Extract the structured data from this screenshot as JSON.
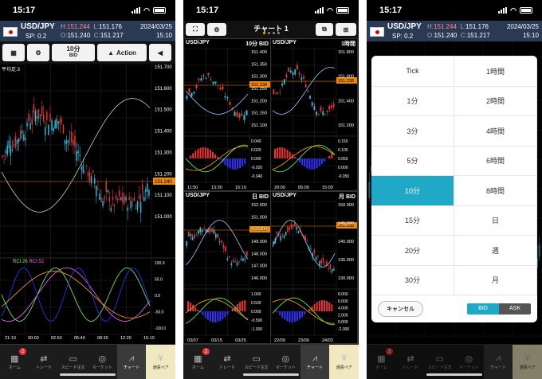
{
  "status": {
    "time": "15:17"
  },
  "quote": {
    "symbol": "USD/JPY",
    "spread": "SP: 0.2",
    "high_label": "H:",
    "high": "151.244",
    "open_label": "O:",
    "open": "151.240",
    "low_label": "L:",
    "low": "151.176",
    "close_label": "C:",
    "close": "151.217",
    "date": "2024/03/25",
    "time": "15:10"
  },
  "toolbar1": {
    "timeframe": "10分",
    "side": "BID",
    "action": "Action"
  },
  "chart1": {
    "ma_label": "平均足:3",
    "price_ticks": [
      "151.700",
      "151.600",
      "151.500",
      "151.400",
      "151.300",
      "151.200",
      "151.100",
      "151.000"
    ],
    "current_price": "151.240",
    "osc_labels": [
      "RCI:26",
      "RCI:52"
    ],
    "osc_ticks": [
      "100.0",
      "50.0",
      "0.0",
      "-50.0",
      "-100.0"
    ],
    "time_ticks": [
      "21:10",
      "00:00",
      "02:50",
      "05:40",
      "08:30",
      "12:20",
      "15:10"
    ]
  },
  "screen2": {
    "title": "チャート 1",
    "panels": [
      {
        "symbol": "USD/JPY",
        "tf": "10分",
        "side": "BID",
        "price": "151.238",
        "ticks": [
          "151.400",
          "151.350",
          "151.300",
          "151.250",
          "151.200",
          "151.150",
          "151.100"
        ],
        "osc_ticks": [
          "0.040",
          "0.020",
          "0.000",
          "-0.020",
          "-0.040"
        ],
        "time_ticks": [
          "11:50",
          "13:30",
          "15:10"
        ]
      },
      {
        "symbol": "USD/JPY",
        "tf": "1時間",
        "side": "",
        "price": "151.238",
        "ticks": [
          "151.800",
          "151.600",
          "151.400",
          "151.200"
        ],
        "osc_ticks": [
          "0.150",
          "0.100",
          "0.050",
          "0.000",
          "-0.050"
        ],
        "time_ticks": [
          "20:00",
          "05:00",
          "15:00"
        ]
      },
      {
        "symbol": "USD/JPY",
        "tf": "日",
        "side": "BID",
        "price": "151.238",
        "ticks": [
          "152.000",
          "151.000",
          "150.000",
          "149.000",
          "148.000",
          "147.000",
          "146.000"
        ],
        "osc_ticks": [
          "1.000",
          "0.500",
          "0.000",
          "-0.500",
          "-1.000"
        ],
        "time_ticks": [
          "03/07",
          "03/15",
          "03/25"
        ]
      },
      {
        "symbol": "USD/JPY",
        "tf": "月",
        "side": "BID",
        "price": "151.238",
        "ticks": [
          "150.000",
          "145.000",
          "140.000",
          "135.000",
          "130.000"
        ],
        "osc_ticks": [
          "8.000",
          "6.000",
          "4.000",
          "2.000",
          "0.000",
          "-2.000"
        ],
        "time_ticks": [
          "22/09",
          "23/06",
          "24/03"
        ]
      }
    ]
  },
  "tabs": [
    {
      "label": "ホーム",
      "icon": "home-icon",
      "glyph": "▦",
      "badge": "2"
    },
    {
      "label": "トレード",
      "icon": "trade-icon",
      "glyph": "⇄",
      "badge": ""
    },
    {
      "label": "スピード注文",
      "icon": "speed-order-icon",
      "glyph": "▭",
      "badge": ""
    },
    {
      "label": "マーケット",
      "icon": "market-icon",
      "glyph": "◎",
      "badge": ""
    },
    {
      "label": "チャート",
      "icon": "chart-icon",
      "glyph": "⩘",
      "badge": ""
    },
    {
      "label": "通貨ペア",
      "icon": "currency-pair-icon",
      "glyph": "¥",
      "badge": ""
    }
  ],
  "picker": {
    "left": [
      "Tick",
      "1分",
      "3分",
      "5分",
      "10分",
      "15分",
      "20分",
      "30分"
    ],
    "right": [
      "1時間",
      "2時間",
      "4時間",
      "6時間",
      "8時間",
      "日",
      "週",
      "月"
    ],
    "selected": "10分",
    "cancel": "キャンセル",
    "bid": "BID",
    "ask": "ASK"
  }
}
